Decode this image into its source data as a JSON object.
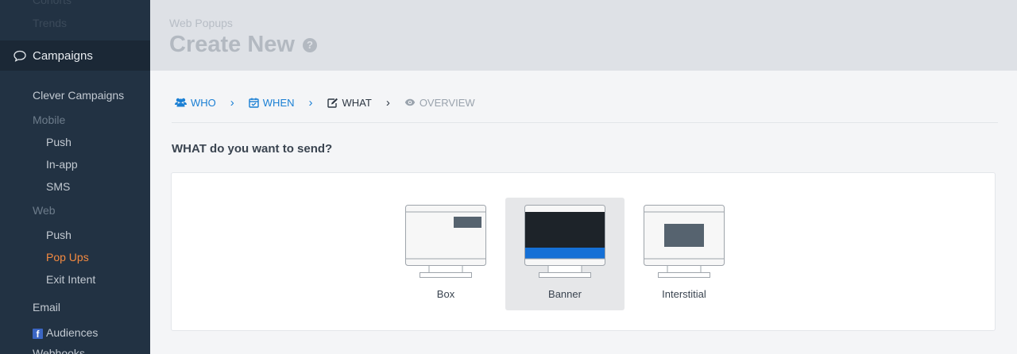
{
  "sidebar": {
    "faded_items": [
      "Cohorts",
      "Trends"
    ],
    "section": "Campaigns",
    "items": [
      {
        "label": "Clever Campaigns"
      },
      {
        "label": "Mobile"
      },
      {
        "label": "Push"
      },
      {
        "label": "In-app"
      },
      {
        "label": "SMS"
      },
      {
        "label": "Web"
      },
      {
        "label": "Push"
      },
      {
        "label": "Pop Ups"
      },
      {
        "label": "Exit Intent"
      },
      {
        "label": "Email"
      },
      {
        "label": "Audiences"
      },
      {
        "label": "Webhooks"
      }
    ],
    "active_item": "Pop Ups"
  },
  "header": {
    "breadcrumb": "Web Popups",
    "title": "Create New",
    "help_glyph": "?"
  },
  "steps": [
    {
      "label": "WHO",
      "icon": "users-icon",
      "state": "done"
    },
    {
      "label": "WHEN",
      "icon": "calendar-icon",
      "state": "done"
    },
    {
      "label": "WHAT",
      "icon": "edit-icon",
      "state": "current"
    },
    {
      "label": "OVERVIEW",
      "icon": "eye-icon",
      "state": "future"
    }
  ],
  "question": "WHAT do you want to send?",
  "options": [
    {
      "label": "Box",
      "selected": false
    },
    {
      "label": "Banner",
      "selected": true
    },
    {
      "label": "Interstitial",
      "selected": false
    }
  ],
  "colors": {
    "sidebar_bg": "#223243",
    "active": "#f48a40",
    "link": "#1a7fd4",
    "banner_blue": "#1570d6",
    "dark_screen": "#1d2329"
  }
}
